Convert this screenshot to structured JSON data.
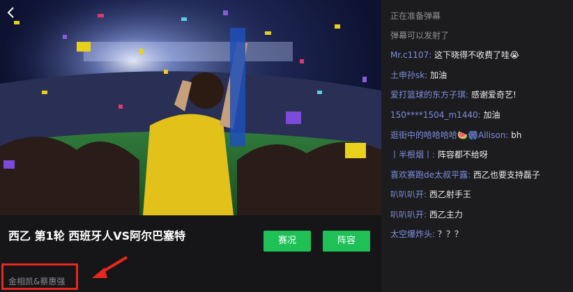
{
  "player": {
    "title": "西乙 第1轮 西班牙人VS阿尔巴塞特",
    "buttons": {
      "situation": "赛况",
      "lineup": "阵容"
    },
    "commentators": "金相凯&蔡惠强"
  },
  "danmaku": {
    "system": [
      "正在准备弹幕",
      "弹幕可以发射了"
    ],
    "messages": [
      {
        "user": "Mr.c1107:",
        "text": "这下晓得不收费了哇😭"
      },
      {
        "user": "土申孙sk:",
        "text": "加油"
      },
      {
        "user": "爱打篮球的东方子琪:",
        "text": "感谢爱奇艺!"
      },
      {
        "user": "150****1504_m1440:",
        "text": "加油"
      },
      {
        "user": "逛街中的哈哈哈哈🍉🎆Allison:",
        "text": "bh"
      },
      {
        "user": "丨半根烟丨:",
        "text": "阵容都不给呀"
      },
      {
        "user": "喜欢赛跑de太叔平露:",
        "text": "西乙也要支持磊子"
      },
      {
        "user": "叭叭叭开:",
        "text": "西乙射手王"
      },
      {
        "user": "叭叭叭开:",
        "text": "西乙主力"
      },
      {
        "user": "太空爆炸头:",
        "text": "？？？"
      }
    ]
  },
  "colors": {
    "accent_green": "#1fc157",
    "highlight_red": "#e8271d",
    "username_blue": "#7d8fe0"
  },
  "icons": [
    "back-chevron-icon",
    "annotation-arrow-icon"
  ]
}
